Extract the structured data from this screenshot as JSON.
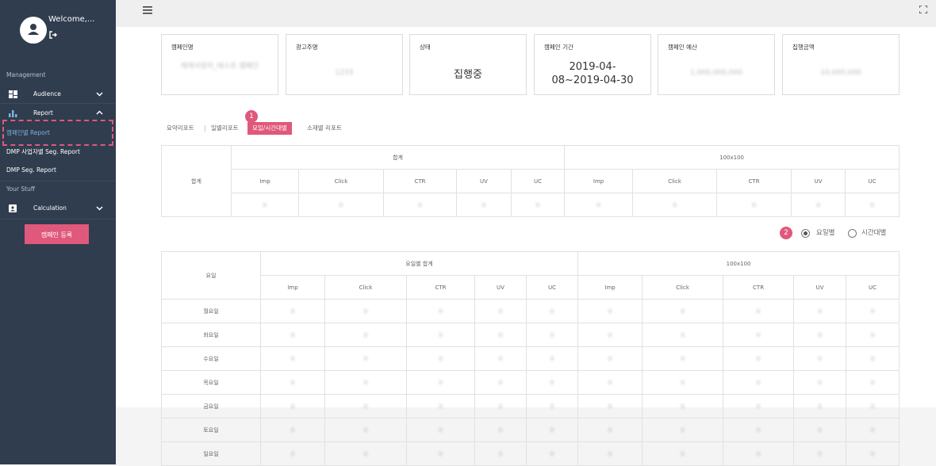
{
  "user": {
    "welcome": "Welcome,..."
  },
  "sidebar": {
    "management_label": "Management",
    "audience": "Audience",
    "report": "Report",
    "report_items": [
      "캠페인별 Report",
      "DMP 사업자별 Seg. Report",
      "DMP Seg. Report"
    ],
    "your_stuff_label": "Your Stuff",
    "calculation": "Calculation",
    "register_button": "캠페인 등록"
  },
  "cards": [
    {
      "title": "캠페인명",
      "value": "캐캐사장자_테스트 캠페인"
    },
    {
      "title": "광고주명",
      "value": "1233"
    },
    {
      "title": "상태",
      "value": "집행중"
    },
    {
      "title": "캠페인 기간",
      "value_line1": "2019-04-",
      "value_line2": "08~2019-04-30"
    },
    {
      "title": "캠페인 예산",
      "value": "1,000,000,000"
    },
    {
      "title": "집행금액",
      "value": "10,000,000"
    }
  ],
  "tabs": [
    "요약리포트",
    "일별리포트",
    "요일/시간대별",
    "소재별 리포트"
  ],
  "annotations": {
    "badge1": "1",
    "badge2": "2"
  },
  "summary_table": {
    "row_label": "합계",
    "group1": "합계",
    "group2": "100x100",
    "columns": [
      "Imp",
      "Click",
      "CTR",
      "UV",
      "UC",
      "Imp",
      "Click",
      "CTR",
      "UV",
      "UC"
    ],
    "values": [
      "0",
      "0",
      "0",
      "0",
      "0",
      "0",
      "0",
      "0",
      "0",
      "0"
    ]
  },
  "radio": {
    "option1": "요일별",
    "option2": "시간대별"
  },
  "day_table": {
    "row_header": "요일",
    "group1": "요일별 합계",
    "group2": "100x100",
    "columns": [
      "Imp",
      "Click",
      "CTR",
      "UV",
      "UC",
      "Imp",
      "Click",
      "CTR",
      "UV",
      "UC"
    ],
    "rows": [
      {
        "day": "월요일",
        "values": [
          "0",
          "0",
          "0",
          "0",
          "0",
          "0",
          "0",
          "0",
          "0",
          "0"
        ]
      },
      {
        "day": "화요일",
        "values": [
          "0",
          "0",
          "0",
          "0",
          "0",
          "0",
          "0",
          "0",
          "0",
          "0"
        ]
      },
      {
        "day": "수요일",
        "values": [
          "0",
          "0",
          "0",
          "0",
          "0",
          "0",
          "0",
          "0",
          "0",
          "0"
        ]
      },
      {
        "day": "목요일",
        "values": [
          "0",
          "0",
          "0",
          "0",
          "0",
          "0",
          "0",
          "0",
          "0",
          "0"
        ]
      },
      {
        "day": "금요일",
        "values": [
          "0",
          "0",
          "0",
          "0",
          "0",
          "0",
          "0",
          "0",
          "0",
          "0"
        ]
      },
      {
        "day": "토요일",
        "values": [
          "0",
          "0",
          "0",
          "0",
          "0",
          "0",
          "0",
          "0",
          "0",
          "0"
        ]
      },
      {
        "day": "일요일",
        "values": [
          "0",
          "0",
          "0",
          "0",
          "0",
          "0",
          "0",
          "0",
          "0",
          "0"
        ]
      }
    ]
  },
  "colors": {
    "sidebar": "#2f3d4e",
    "accent": "#e0587b",
    "active_link": "#7fb0de"
  }
}
